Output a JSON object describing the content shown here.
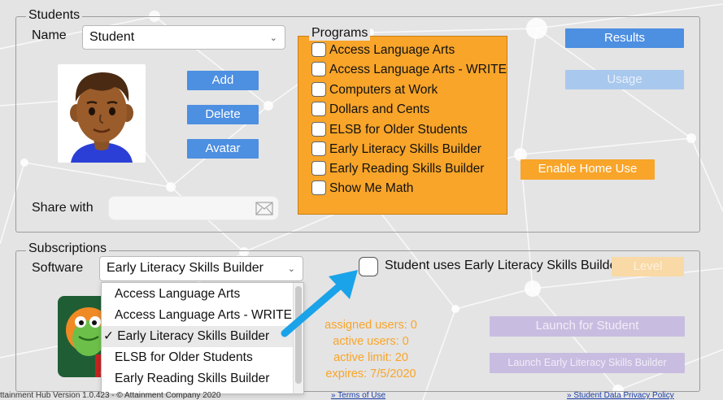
{
  "students": {
    "legend": "Students",
    "name_label": "Name",
    "name_value": "Student",
    "buttons": {
      "add": "Add",
      "delete": "Delete",
      "avatar": "Avatar"
    },
    "share_label": "Share with",
    "share_value": ""
  },
  "programs": {
    "legend": "Programs",
    "items": [
      {
        "label": "Access Language Arts",
        "checked": false
      },
      {
        "label": "Access Language Arts - WRITE",
        "checked": false
      },
      {
        "label": "Computers at Work",
        "checked": false
      },
      {
        "label": "Dollars and Cents",
        "checked": false
      },
      {
        "label": "ELSB for Older Students",
        "checked": false
      },
      {
        "label": "Early Literacy Skills Builder",
        "checked": false
      },
      {
        "label": "Early Reading Skills Builder",
        "checked": false
      },
      {
        "label": "Show Me Math",
        "checked": false
      }
    ]
  },
  "right_buttons": {
    "results": "Results",
    "usage": "Usage",
    "enable_home_use": "Enable Home Use"
  },
  "subscriptions": {
    "legend": "Subscriptions",
    "software_label": "Software",
    "software_value": "Early Literacy Skills Builder",
    "dropdown_options": [
      {
        "label": "Access Language Arts",
        "selected": false
      },
      {
        "label": "Access Language Arts - WRITE",
        "selected": false
      },
      {
        "label": "✓ Early Literacy Skills Builder",
        "selected": true
      },
      {
        "label": "ELSB for Older Students",
        "selected": false
      },
      {
        "label": "Early Reading Skills Builder",
        "selected": false
      }
    ],
    "uses_checkbox_label": "Student uses Early Literacy Skills Builder",
    "level_button": "Level",
    "stats": {
      "assigned": "assigned users: 0",
      "active": "active users: 0",
      "limit": "active limit: 20",
      "expires": "expires: 7/5/2020"
    },
    "launch_for_student": "Launch for Student",
    "launch_app": "Launch Early Literacy Skills Builder"
  },
  "footer": {
    "version": "ttainment Hub Version 1.0.423 - © Attainment Company 2020",
    "terms": "» Terms of Use",
    "privacy": "» Student Data Privacy Policy"
  },
  "colors": {
    "accent_blue": "#4d8fe1",
    "programs_orange": "#f8a52a",
    "arrow_blue": "#1aa3e8"
  }
}
